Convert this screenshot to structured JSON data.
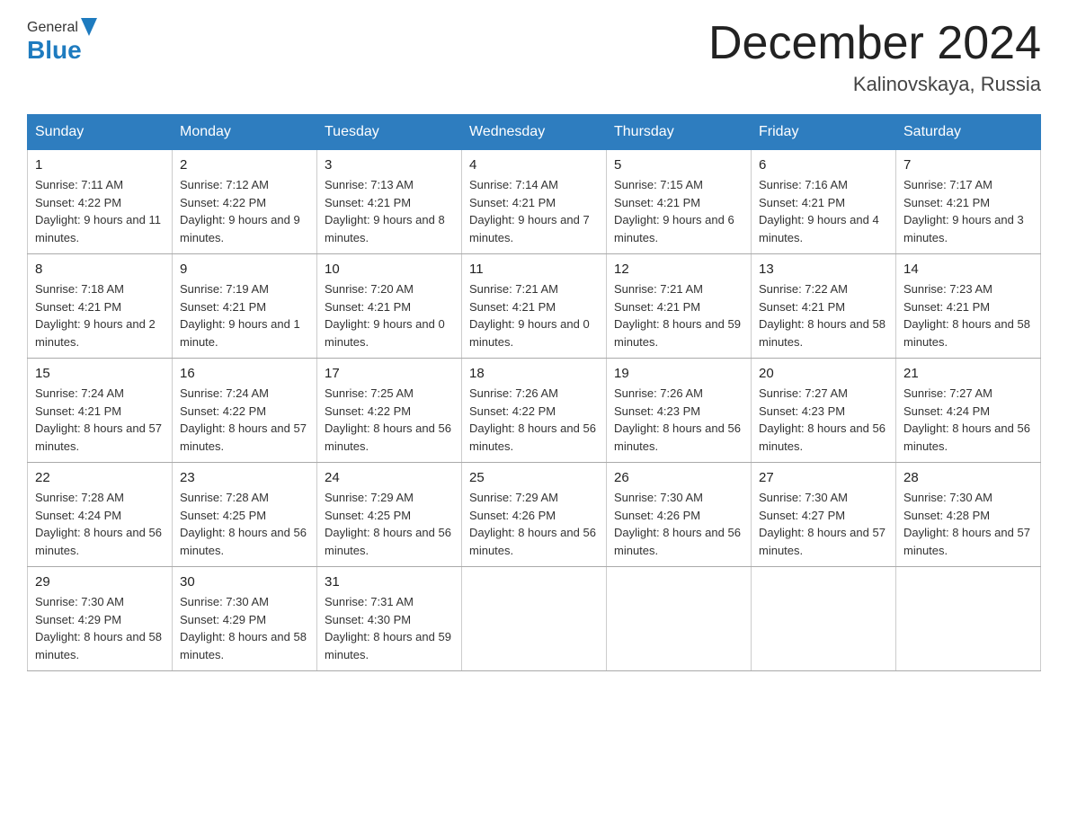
{
  "header": {
    "logo_general": "General",
    "logo_blue": "Blue",
    "month_title": "December 2024",
    "location": "Kalinovskaya, Russia"
  },
  "days_of_week": [
    "Sunday",
    "Monday",
    "Tuesday",
    "Wednesday",
    "Thursday",
    "Friday",
    "Saturday"
  ],
  "weeks": [
    [
      {
        "day": "1",
        "sunrise": "7:11 AM",
        "sunset": "4:22 PM",
        "daylight": "9 hours and 11 minutes."
      },
      {
        "day": "2",
        "sunrise": "7:12 AM",
        "sunset": "4:22 PM",
        "daylight": "9 hours and 9 minutes."
      },
      {
        "day": "3",
        "sunrise": "7:13 AM",
        "sunset": "4:21 PM",
        "daylight": "9 hours and 8 minutes."
      },
      {
        "day": "4",
        "sunrise": "7:14 AM",
        "sunset": "4:21 PM",
        "daylight": "9 hours and 7 minutes."
      },
      {
        "day": "5",
        "sunrise": "7:15 AM",
        "sunset": "4:21 PM",
        "daylight": "9 hours and 6 minutes."
      },
      {
        "day": "6",
        "sunrise": "7:16 AM",
        "sunset": "4:21 PM",
        "daylight": "9 hours and 4 minutes."
      },
      {
        "day": "7",
        "sunrise": "7:17 AM",
        "sunset": "4:21 PM",
        "daylight": "9 hours and 3 minutes."
      }
    ],
    [
      {
        "day": "8",
        "sunrise": "7:18 AM",
        "sunset": "4:21 PM",
        "daylight": "9 hours and 2 minutes."
      },
      {
        "day": "9",
        "sunrise": "7:19 AM",
        "sunset": "4:21 PM",
        "daylight": "9 hours and 1 minute."
      },
      {
        "day": "10",
        "sunrise": "7:20 AM",
        "sunset": "4:21 PM",
        "daylight": "9 hours and 0 minutes."
      },
      {
        "day": "11",
        "sunrise": "7:21 AM",
        "sunset": "4:21 PM",
        "daylight": "9 hours and 0 minutes."
      },
      {
        "day": "12",
        "sunrise": "7:21 AM",
        "sunset": "4:21 PM",
        "daylight": "8 hours and 59 minutes."
      },
      {
        "day": "13",
        "sunrise": "7:22 AM",
        "sunset": "4:21 PM",
        "daylight": "8 hours and 58 minutes."
      },
      {
        "day": "14",
        "sunrise": "7:23 AM",
        "sunset": "4:21 PM",
        "daylight": "8 hours and 58 minutes."
      }
    ],
    [
      {
        "day": "15",
        "sunrise": "7:24 AM",
        "sunset": "4:21 PM",
        "daylight": "8 hours and 57 minutes."
      },
      {
        "day": "16",
        "sunrise": "7:24 AM",
        "sunset": "4:22 PM",
        "daylight": "8 hours and 57 minutes."
      },
      {
        "day": "17",
        "sunrise": "7:25 AM",
        "sunset": "4:22 PM",
        "daylight": "8 hours and 56 minutes."
      },
      {
        "day": "18",
        "sunrise": "7:26 AM",
        "sunset": "4:22 PM",
        "daylight": "8 hours and 56 minutes."
      },
      {
        "day": "19",
        "sunrise": "7:26 AM",
        "sunset": "4:23 PM",
        "daylight": "8 hours and 56 minutes."
      },
      {
        "day": "20",
        "sunrise": "7:27 AM",
        "sunset": "4:23 PM",
        "daylight": "8 hours and 56 minutes."
      },
      {
        "day": "21",
        "sunrise": "7:27 AM",
        "sunset": "4:24 PM",
        "daylight": "8 hours and 56 minutes."
      }
    ],
    [
      {
        "day": "22",
        "sunrise": "7:28 AM",
        "sunset": "4:24 PM",
        "daylight": "8 hours and 56 minutes."
      },
      {
        "day": "23",
        "sunrise": "7:28 AM",
        "sunset": "4:25 PM",
        "daylight": "8 hours and 56 minutes."
      },
      {
        "day": "24",
        "sunrise": "7:29 AM",
        "sunset": "4:25 PM",
        "daylight": "8 hours and 56 minutes."
      },
      {
        "day": "25",
        "sunrise": "7:29 AM",
        "sunset": "4:26 PM",
        "daylight": "8 hours and 56 minutes."
      },
      {
        "day": "26",
        "sunrise": "7:30 AM",
        "sunset": "4:26 PM",
        "daylight": "8 hours and 56 minutes."
      },
      {
        "day": "27",
        "sunrise": "7:30 AM",
        "sunset": "4:27 PM",
        "daylight": "8 hours and 57 minutes."
      },
      {
        "day": "28",
        "sunrise": "7:30 AM",
        "sunset": "4:28 PM",
        "daylight": "8 hours and 57 minutes."
      }
    ],
    [
      {
        "day": "29",
        "sunrise": "7:30 AM",
        "sunset": "4:29 PM",
        "daylight": "8 hours and 58 minutes."
      },
      {
        "day": "30",
        "sunrise": "7:30 AM",
        "sunset": "4:29 PM",
        "daylight": "8 hours and 58 minutes."
      },
      {
        "day": "31",
        "sunrise": "7:31 AM",
        "sunset": "4:30 PM",
        "daylight": "8 hours and 59 minutes."
      },
      null,
      null,
      null,
      null
    ]
  ],
  "labels": {
    "sunrise": "Sunrise:",
    "sunset": "Sunset:",
    "daylight": "Daylight:"
  }
}
